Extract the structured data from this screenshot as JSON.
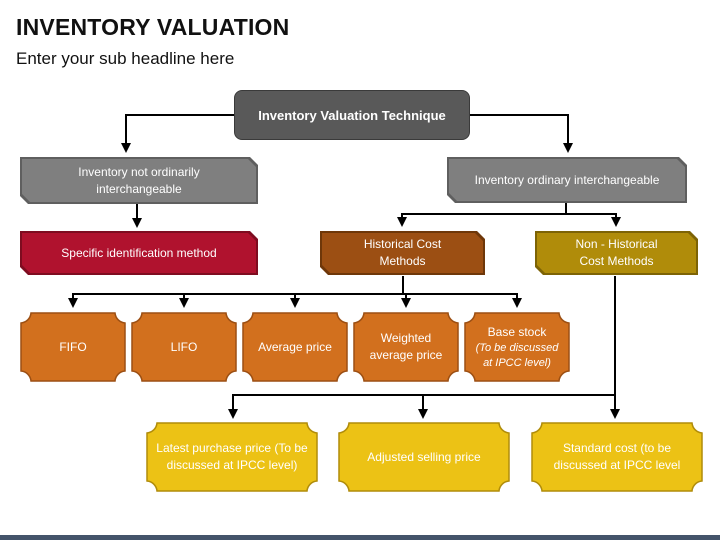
{
  "header": {
    "title": "INVENTORY VALUATION",
    "subtitle": "Enter your sub headline here"
  },
  "colors": {
    "root": "#595959",
    "category": "#7f7f7f",
    "specific": "#b0122e",
    "historical": "#9c4f13",
    "non_historical": "#b08c0a",
    "historical_method": "#d2701e",
    "non_historical_method": "#ecc215",
    "footer_bar": "#44546a"
  },
  "diagram": {
    "root": {
      "label": "Inventory Valuation Technique"
    },
    "not_interchangeable": {
      "label": "Inventory not ordinarily interchangeable"
    },
    "interchangeable": {
      "label": "Inventory ordinary interchangeable"
    },
    "specific_identification": {
      "label": "Specific identification method"
    },
    "historical_cost": {
      "label": "Historical Cost Methods"
    },
    "non_historical_cost": {
      "label": "Non - Historical Cost Methods"
    },
    "historical_methods": [
      {
        "label": "FIFO",
        "note": ""
      },
      {
        "label": "LIFO",
        "note": ""
      },
      {
        "label": "Average price",
        "note": ""
      },
      {
        "label": "Weighted average price",
        "note": ""
      },
      {
        "label": "Base stock",
        "note": "(To be discussed at IPCC level)"
      }
    ],
    "non_historical_methods": [
      {
        "label": "Latest purchase price (To be discussed at IPCC level)"
      },
      {
        "label": "Adjusted selling price"
      },
      {
        "label": "Standard cost (to be discussed at IPCC level"
      }
    ]
  }
}
